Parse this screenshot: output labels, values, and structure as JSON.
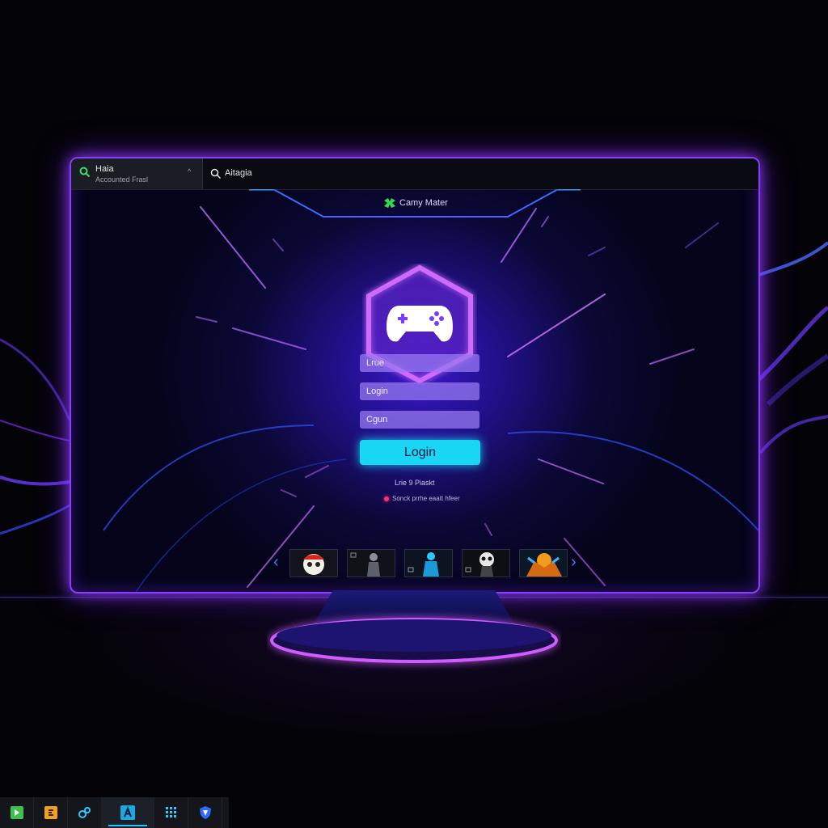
{
  "browser": {
    "tab": {
      "title": "Haia",
      "subtitle": "Accounted Frasl"
    },
    "search": {
      "label": "Aitagia"
    }
  },
  "app": {
    "name": "Camy Mater"
  },
  "login": {
    "fields": [
      {
        "placeholder": "Lrue"
      },
      {
        "placeholder": "Login"
      },
      {
        "placeholder": "Cgun"
      }
    ],
    "button_label": "Login",
    "helper_text": "Lrie 9 Piaskt",
    "status_text": "Sonck prrhe eaatt hfeer"
  },
  "carousel": {
    "prev_label": "‹",
    "next_label": "›",
    "thumbnails": [
      "mask-red-character",
      "dark-armored-character",
      "cyan-warrior-character",
      "skull-face-character",
      "orange-beast-character"
    ]
  },
  "taskbar": {
    "items": [
      "green-app-icon",
      "orange-app-icon",
      "link-app-icon",
      "a-app-icon",
      "grid-app-icon",
      "shield-app-icon"
    ],
    "active_index": 3
  },
  "colors": {
    "accent_purple": "#8b3dff",
    "login_button": "#19d6f5",
    "status_dot": "#ff2e6f"
  }
}
